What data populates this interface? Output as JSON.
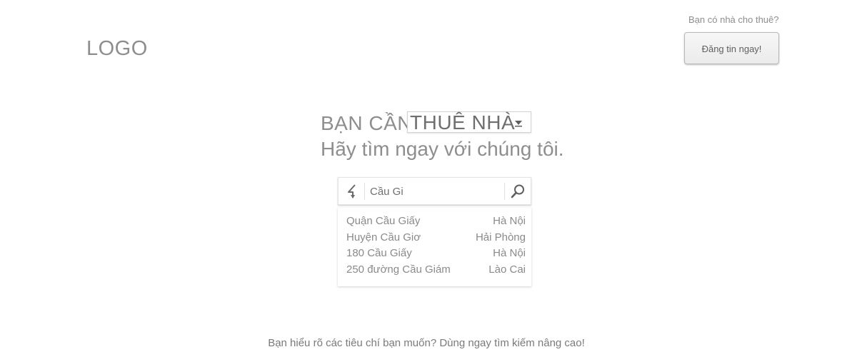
{
  "header": {
    "logo_text": "LOGO",
    "owner_question": "Bạn có nhà cho thuê?",
    "post_button_label": "Đăng tin ngay!"
  },
  "hero": {
    "prefix": "BẠN CẦN",
    "need_options_selected": "THUÊ NHÀ",
    "dropdown_icon": "dropdown-arrow-icon",
    "tagline": "Hãy tìm ngay với chúng tôi."
  },
  "search": {
    "value": "Cầu Gi",
    "placeholder": "",
    "locate_icon": "location-arrow-icon",
    "search_icon": "magnifier-icon"
  },
  "suggestions": [
    {
      "place": "Quận Cầu Giấy",
      "city": "Hà Nội"
    },
    {
      "place": "Huyện Cầu Giơ",
      "city": "Hải Phòng"
    },
    {
      "place": "180 Cầu Giấy",
      "city": "Hà Nội"
    },
    {
      "place": "250 đường Cầu Giám",
      "city": "Lào Cai"
    }
  ],
  "footer": {
    "advanced_search_text": "Bạn hiểu rõ các tiêu chí bạn muốn? Dùng ngay tìm kiếm nâng cao!"
  },
  "colors": {
    "text_light": "#8e8e8e",
    "text_dark": "#6f6f6f",
    "border": "#d3d3d3",
    "background": "#ffffff"
  }
}
